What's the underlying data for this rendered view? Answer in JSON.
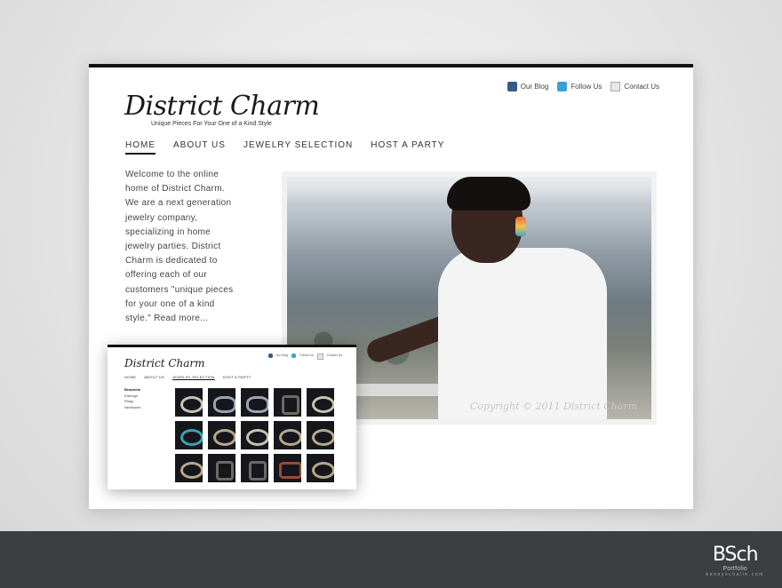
{
  "site": {
    "logo": "District Charm",
    "tagline": "Unique Pieces For Your One of a Kind Style",
    "util_links": [
      {
        "label": "Our Blog",
        "icon": "blog-icon"
      },
      {
        "label": "Follow Us",
        "icon": "twitter-icon"
      },
      {
        "label": "Contact Us",
        "icon": "mail-icon"
      }
    ],
    "nav": [
      "HOME",
      "ABOUT US",
      "JEWELRY SELECTION",
      "HOST A PARTY"
    ],
    "active_nav": "HOME",
    "intro": "Welcome to the online home of District Charm. We are a next generation jewelry company, specializing in home jewelry parties. District Charm is dedicated to offering each of our customers \"unique pieces for your one of a kind style.\" Read more...",
    "hero_watermark": "Copyright © 2011 District Charm"
  },
  "inset": {
    "logo": "District Charm",
    "util_links": [
      "Our Blog",
      "Follow Us",
      "Contact Us"
    ],
    "nav": [
      "HOME",
      "ABOUT US",
      "JEWELRY SELECTION",
      "HOST A PARTY"
    ],
    "active_nav": "JEWELRY SELECTION",
    "categories": [
      "Bracelets",
      "Earrings",
      "Rings",
      "Necklaces"
    ],
    "active_category": "Bracelets"
  },
  "brand": {
    "mark": "BSch",
    "line1": "Portfolio",
    "line2": "bennyschalin.com"
  },
  "colors": {
    "accent": "#111111",
    "bar": "#3c3e41"
  }
}
